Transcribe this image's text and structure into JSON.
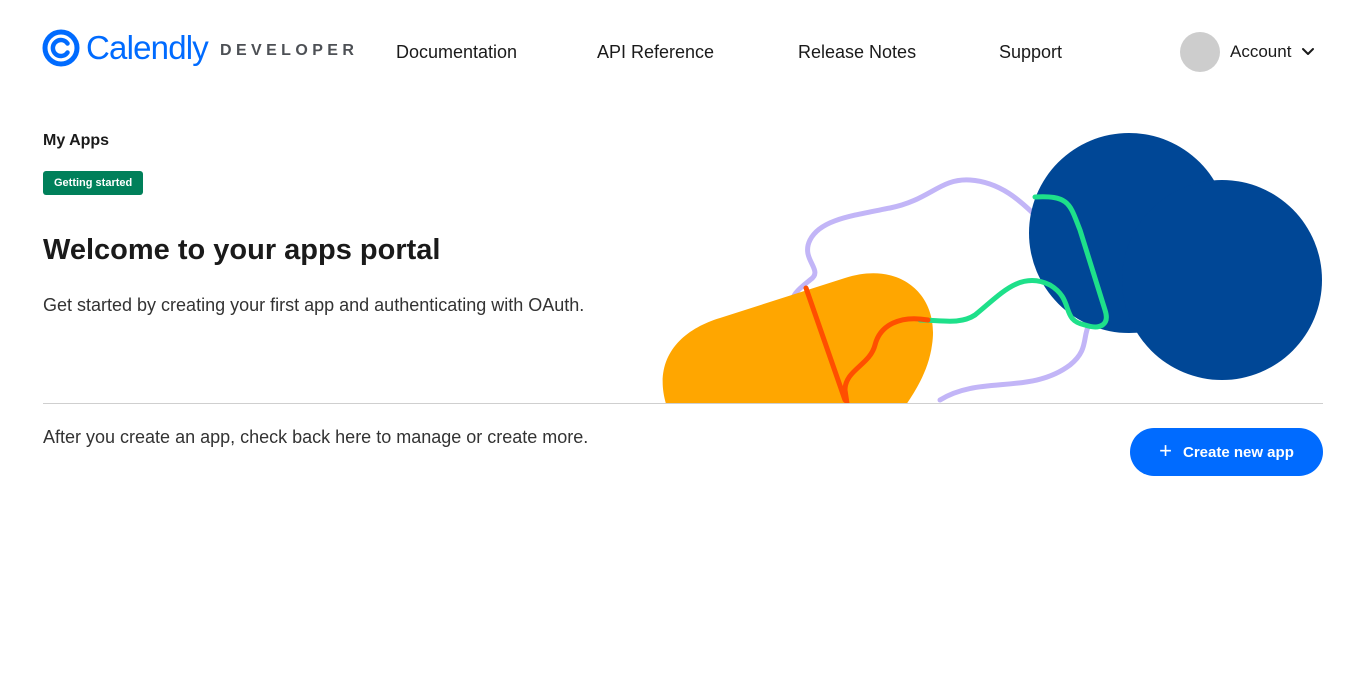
{
  "header": {
    "logo": {
      "wordmark": "Calendly",
      "suffix": "DEVELOPER"
    },
    "nav": [
      {
        "label": "Documentation"
      },
      {
        "label": "API Reference"
      },
      {
        "label": "Release Notes"
      },
      {
        "label": "Support"
      }
    ],
    "account": {
      "label": "Account",
      "icon": "chevron-down-icon"
    }
  },
  "main": {
    "section_title": "My Apps",
    "badge": "Getting started",
    "headline": "Welcome to your apps portal",
    "subtext": "Get started by creating your first app and authenticating with OAuth.",
    "footer_text": "After you create an app, check back here to manage or create more.",
    "create_button": {
      "icon": "plus-icon",
      "label": "Create new app"
    }
  },
  "colors": {
    "brand_blue": "#006bff",
    "navy": "#004796",
    "badge_green": "#00805a",
    "illustration_orange": "#ffa600",
    "illustration_lavender": "#c2b5f7",
    "illustration_green": "#1ee08a",
    "illustration_red": "#ff4f00"
  }
}
